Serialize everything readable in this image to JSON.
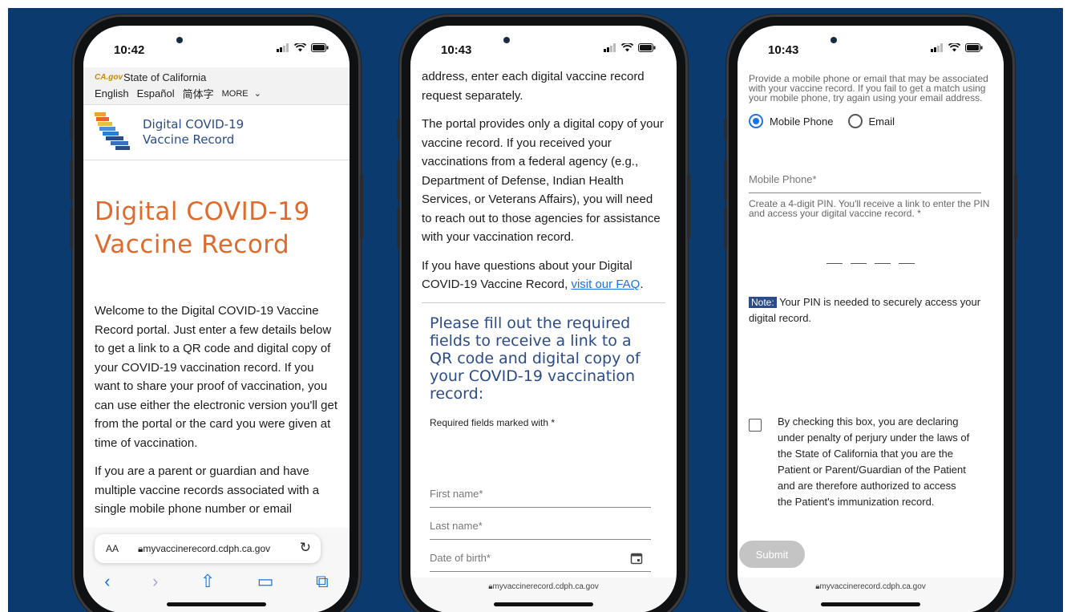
{
  "colors": {
    "background": "#0b3a6f",
    "accent": "#1a73e8",
    "title_orange": "#e06a2c",
    "heading_blue": "#2b4b8a"
  },
  "phone1": {
    "time": "10:42",
    "cagov_logo": "CA.gov",
    "state_label": "State of California",
    "languages": [
      "English",
      "Español",
      "简体字"
    ],
    "more_label": "MORE",
    "site_title_line1": "Digital COVID-19",
    "site_title_line2": "Vaccine Record",
    "heading_line1": "Digital COVID-19",
    "heading_line2": "Vaccine Record",
    "intro": "Welcome to the Digital COVID-19 Vaccine Record portal. Just enter a few details below to get a link to a QR code and digital copy of your COVID-19 vaccination record. If you want to share your proof of vaccination, you can use either the electronic version you'll get from the portal or the card you were given at time of vaccination.",
    "parent_text": "If you are a parent or guardian and have multiple vaccine records associated with a single mobile phone number or email",
    "safari": {
      "aa": "AA",
      "url": "myvaccinerecord.cdph.ca.gov",
      "icons": [
        "back-icon",
        "forward-icon",
        "share-icon",
        "bookmarks-icon",
        "tabs-icon"
      ]
    }
  },
  "phone2": {
    "time": "10:43",
    "para1": "address, enter each digital vaccine record request separately.",
    "para2": "The portal provides only a digital copy of your vaccine record. If you received your vaccinations from a federal agency (e.g., Department of Defense, Indian Health Services, or Veterans Affairs), you will need to reach out to those agencies for assistance with your vaccination record.",
    "para3_prefix": "If you have questions about your Digital COVID-19 Vaccine Record, ",
    "faq_link": "visit our FAQ",
    "para3_suffix": ".",
    "form_title": "Please fill out the required fields to receive a link to a QR code and digital copy of your COVID-19 vaccination record:",
    "required_note": "Required fields marked with *",
    "first_name": "First name*",
    "last_name": "Last name*",
    "dob": "Date of birth*",
    "footer_url": "myvaccinerecord.cdph.ca.gov"
  },
  "phone3": {
    "time": "10:43",
    "hint": "Provide a mobile phone or email that may be associated with your vaccine record. If you fail to get a match using your mobile phone, try again using your email address.",
    "radio_phone": "Mobile Phone",
    "radio_email": "Email",
    "selected": "Mobile Phone",
    "phone_field": "Mobile Phone*",
    "pin_hint": "Create a 4-digit PIN. You'll receive a link to enter the PIN and access your digital vaccine record. *",
    "note_badge": "Note:",
    "note_text": " Your PIN is needed to securely access your digital record.",
    "declaration": "By checking this box, you are declaring under penalty of perjury under the laws of the State of California that you are the Patient or Parent/Guardian of the Patient and are therefore authorized to access the Patient's immunization record.",
    "submit": "Submit",
    "footer_url": "myvaccinerecord.cdph.ca.gov"
  }
}
